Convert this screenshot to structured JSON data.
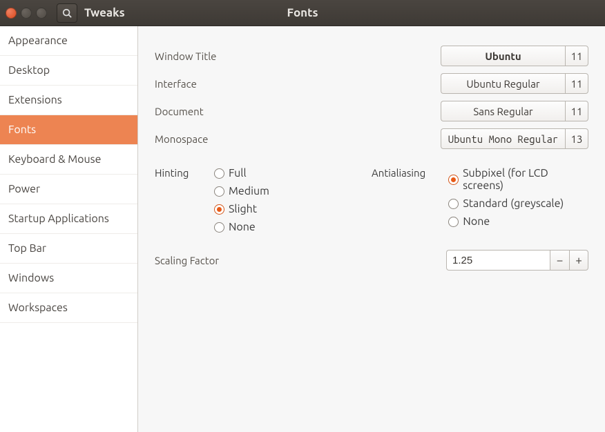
{
  "titlebar": {
    "app_title": "Tweaks",
    "page_title": "Fonts"
  },
  "sidebar": {
    "items": [
      {
        "label": "Appearance"
      },
      {
        "label": "Desktop"
      },
      {
        "label": "Extensions"
      },
      {
        "label": "Fonts"
      },
      {
        "label": "Keyboard & Mouse"
      },
      {
        "label": "Power"
      },
      {
        "label": "Startup Applications"
      },
      {
        "label": "Top Bar"
      },
      {
        "label": "Windows"
      },
      {
        "label": "Workspaces"
      }
    ],
    "selected_index": 3
  },
  "fonts": {
    "window_title": {
      "label": "Window Title",
      "name": "Ubuntu",
      "size": "11"
    },
    "interface": {
      "label": "Interface",
      "name": "Ubuntu Regular",
      "size": "11"
    },
    "document": {
      "label": "Document",
      "name": "Sans Regular",
      "size": "11"
    },
    "monospace": {
      "label": "Monospace",
      "name": "Ubuntu Mono Regular",
      "size": "13"
    }
  },
  "hinting": {
    "label": "Hinting",
    "options": [
      "Full",
      "Medium",
      "Slight",
      "None"
    ],
    "selected": "Slight"
  },
  "antialiasing": {
    "label": "Antialiasing",
    "options": [
      "Subpixel (for LCD screens)",
      "Standard (greyscale)",
      "None"
    ],
    "selected": "Subpixel (for LCD screens)"
  },
  "scaling": {
    "label": "Scaling Factor",
    "value": "1.25"
  }
}
